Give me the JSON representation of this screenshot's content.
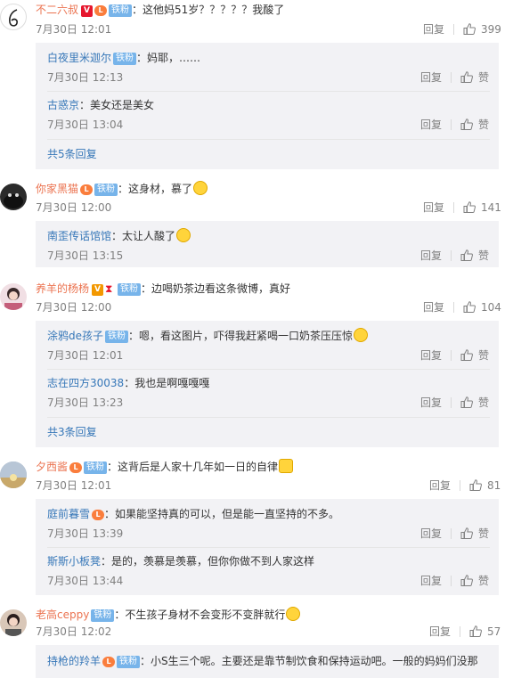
{
  "colors": {
    "username": "#eb7350",
    "reply_username": "#3677b8",
    "badge": "#77b4ea",
    "meta": "#808080",
    "reply_bg": "#f2f2f5"
  },
  "labels": {
    "reply": "回复",
    "like": "赞",
    "fan_badge": "铁粉",
    "like_icon": "thumbs-up-icon"
  },
  "comments": [
    {
      "user": "不二六叔",
      "sep": "：",
      "text": "这他妈51岁？？？？？我酸了",
      "time": "7月30日 12:01",
      "likes": "399",
      "replies": [
        {
          "user": "白夜里米迦尔",
          "sep": "：",
          "text": "妈耶，……",
          "time": "7月30日 12:13"
        },
        {
          "user": "古惑京",
          "sep": "：",
          "text": "美女还是美女",
          "time": "7月30日 13:04"
        }
      ],
      "more": "共5条回复"
    },
    {
      "user": "你家黑猫",
      "sep": "：",
      "text": "这身材，慕了",
      "time": "7月30日 12:00",
      "likes": "141",
      "replies": [
        {
          "user": "南歪传话馆馆",
          "sep": "：",
          "text": "太让人酸了",
          "time": "7月30日 13:15"
        }
      ]
    },
    {
      "user": "养羊的杨杨",
      "sep": "：",
      "text": "边喝奶茶边看这条微博，真好",
      "time": "7月30日 12:00",
      "likes": "104",
      "replies": [
        {
          "user": "涂鸦de孩子",
          "sep": "：",
          "text": "嗯，看这图片，吓得我赶紧喝一口奶茶压压惊",
          "time": "7月30日 12:01"
        },
        {
          "user": "志在四方30038",
          "sep": "：",
          "text": "我也是啊嘎嘎嘎",
          "time": "7月30日 13:23"
        }
      ],
      "more": "共3条回复"
    },
    {
      "user": "夕西酱",
      "sep": "：",
      "text": "这背后是人家十几年如一日的自律",
      "time": "7月30日 12:01",
      "likes": "81",
      "replies": [
        {
          "user": "庭前暮雪",
          "sep": "：",
          "text": "如果能坚持真的可以，但是能一直坚持的不多。",
          "time": "7月30日 13:39"
        },
        {
          "user": "斯斯小板凳",
          "sep": "：",
          "text": "是的，羡慕是羡慕，但你你做不到人家这样",
          "time": "7月30日 13:44"
        }
      ]
    },
    {
      "user": "老高ceppy",
      "sep": "：",
      "text": "不生孩子身材不会变形不变胖就行",
      "time": "7月30日 12:02",
      "likes": "57",
      "replies": [
        {
          "user": "持枪的羚羊",
          "sep": "：",
          "text": "小S生三个呢。主要还是靠节制饮食和保持运动吧。一般的妈妈们没那"
        }
      ]
    }
  ]
}
